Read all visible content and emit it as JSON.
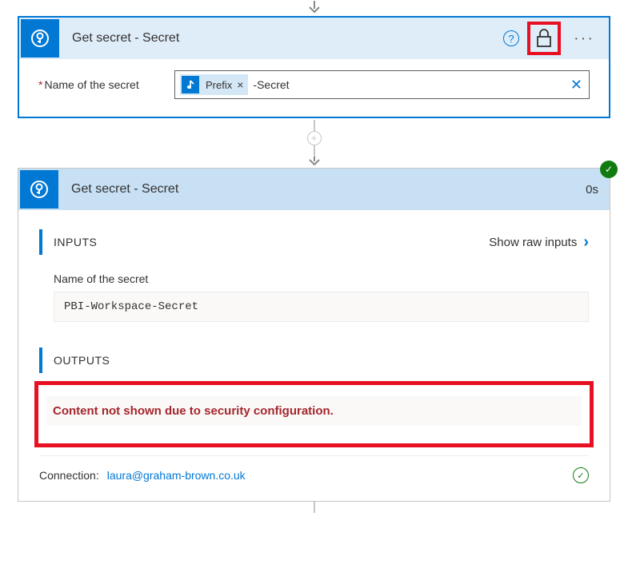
{
  "card1": {
    "title": "Get secret - Secret",
    "field_label": "Name of the secret",
    "token_label": "Prefix",
    "input_suffix": "-Secret"
  },
  "card2": {
    "title": "Get secret - Secret",
    "duration": "0s",
    "inputs": {
      "section_title": "INPUTS",
      "show_raw_label": "Show raw inputs",
      "field_label": "Name of the secret",
      "field_value": "PBI-Workspace-Secret"
    },
    "outputs": {
      "section_title": "OUTPUTS",
      "security_message": "Content not shown due to security configuration."
    },
    "connection": {
      "label": "Connection:",
      "value": "laura@graham-brown.co.uk"
    }
  }
}
